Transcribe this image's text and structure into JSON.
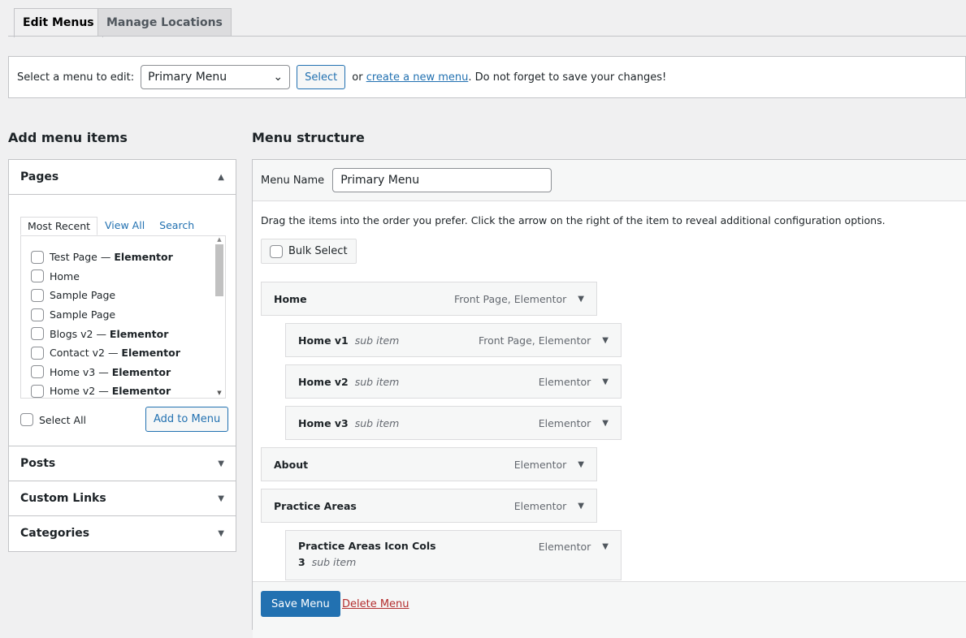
{
  "tabs": [
    {
      "label": "Edit Menus",
      "active": true
    },
    {
      "label": "Manage Locations",
      "active": false
    }
  ],
  "select_bar": {
    "label": "Select a menu to edit:",
    "selected": "Primary Menu",
    "select_button": "Select",
    "or_text": "or",
    "create_link": "create a new menu",
    "suffix": ". Do not forget to save your changes!"
  },
  "left": {
    "heading": "Add menu items",
    "pages_section": "Pages",
    "page_tabs": [
      "Most Recent",
      "View All",
      "Search"
    ],
    "pages": [
      {
        "title": "Test Page",
        "tag": "Elementor"
      },
      {
        "title": "Home",
        "tag": ""
      },
      {
        "title": "Sample Page",
        "tag": ""
      },
      {
        "title": "Sample Page",
        "tag": ""
      },
      {
        "title": "Blogs v2",
        "tag": "Elementor"
      },
      {
        "title": "Contact v2",
        "tag": "Elementor"
      },
      {
        "title": "Home v3",
        "tag": "Elementor"
      },
      {
        "title": "Home v2",
        "tag": "Elementor"
      }
    ],
    "select_all": "Select All",
    "add_button": "Add to Menu",
    "sections": [
      "Posts",
      "Custom Links",
      "Categories"
    ]
  },
  "right": {
    "heading": "Menu structure",
    "menu_name_label": "Menu Name",
    "menu_name_value": "Primary Menu",
    "instructions": "Drag the items into the order you prefer. Click the arrow on the right of the item to reveal additional configuration options.",
    "bulk_select": "Bulk Select",
    "items": [
      {
        "title": "Home",
        "sub": "",
        "meta": "Front Page, Elementor",
        "depth": 0
      },
      {
        "title": "Home v1",
        "sub": "sub item",
        "meta": "Front Page, Elementor",
        "depth": 1
      },
      {
        "title": "Home v2",
        "sub": "sub item",
        "meta": "Elementor",
        "depth": 1
      },
      {
        "title": "Home v3",
        "sub": "sub item",
        "meta": "Elementor",
        "depth": 1
      },
      {
        "title": "About",
        "sub": "",
        "meta": "Elementor",
        "depth": 0
      },
      {
        "title": "Practice Areas",
        "sub": "",
        "meta": "Elementor",
        "depth": 0
      },
      {
        "title": "Practice Areas Icon Cols 3",
        "sub": "sub item",
        "meta": "Elementor",
        "depth": 1
      }
    ],
    "save_button": "Save Menu",
    "delete_link": "Delete Menu"
  },
  "colors": {
    "accent": "#2271b1",
    "delete": "#b32d2e",
    "primary_button": "#2271b1"
  }
}
